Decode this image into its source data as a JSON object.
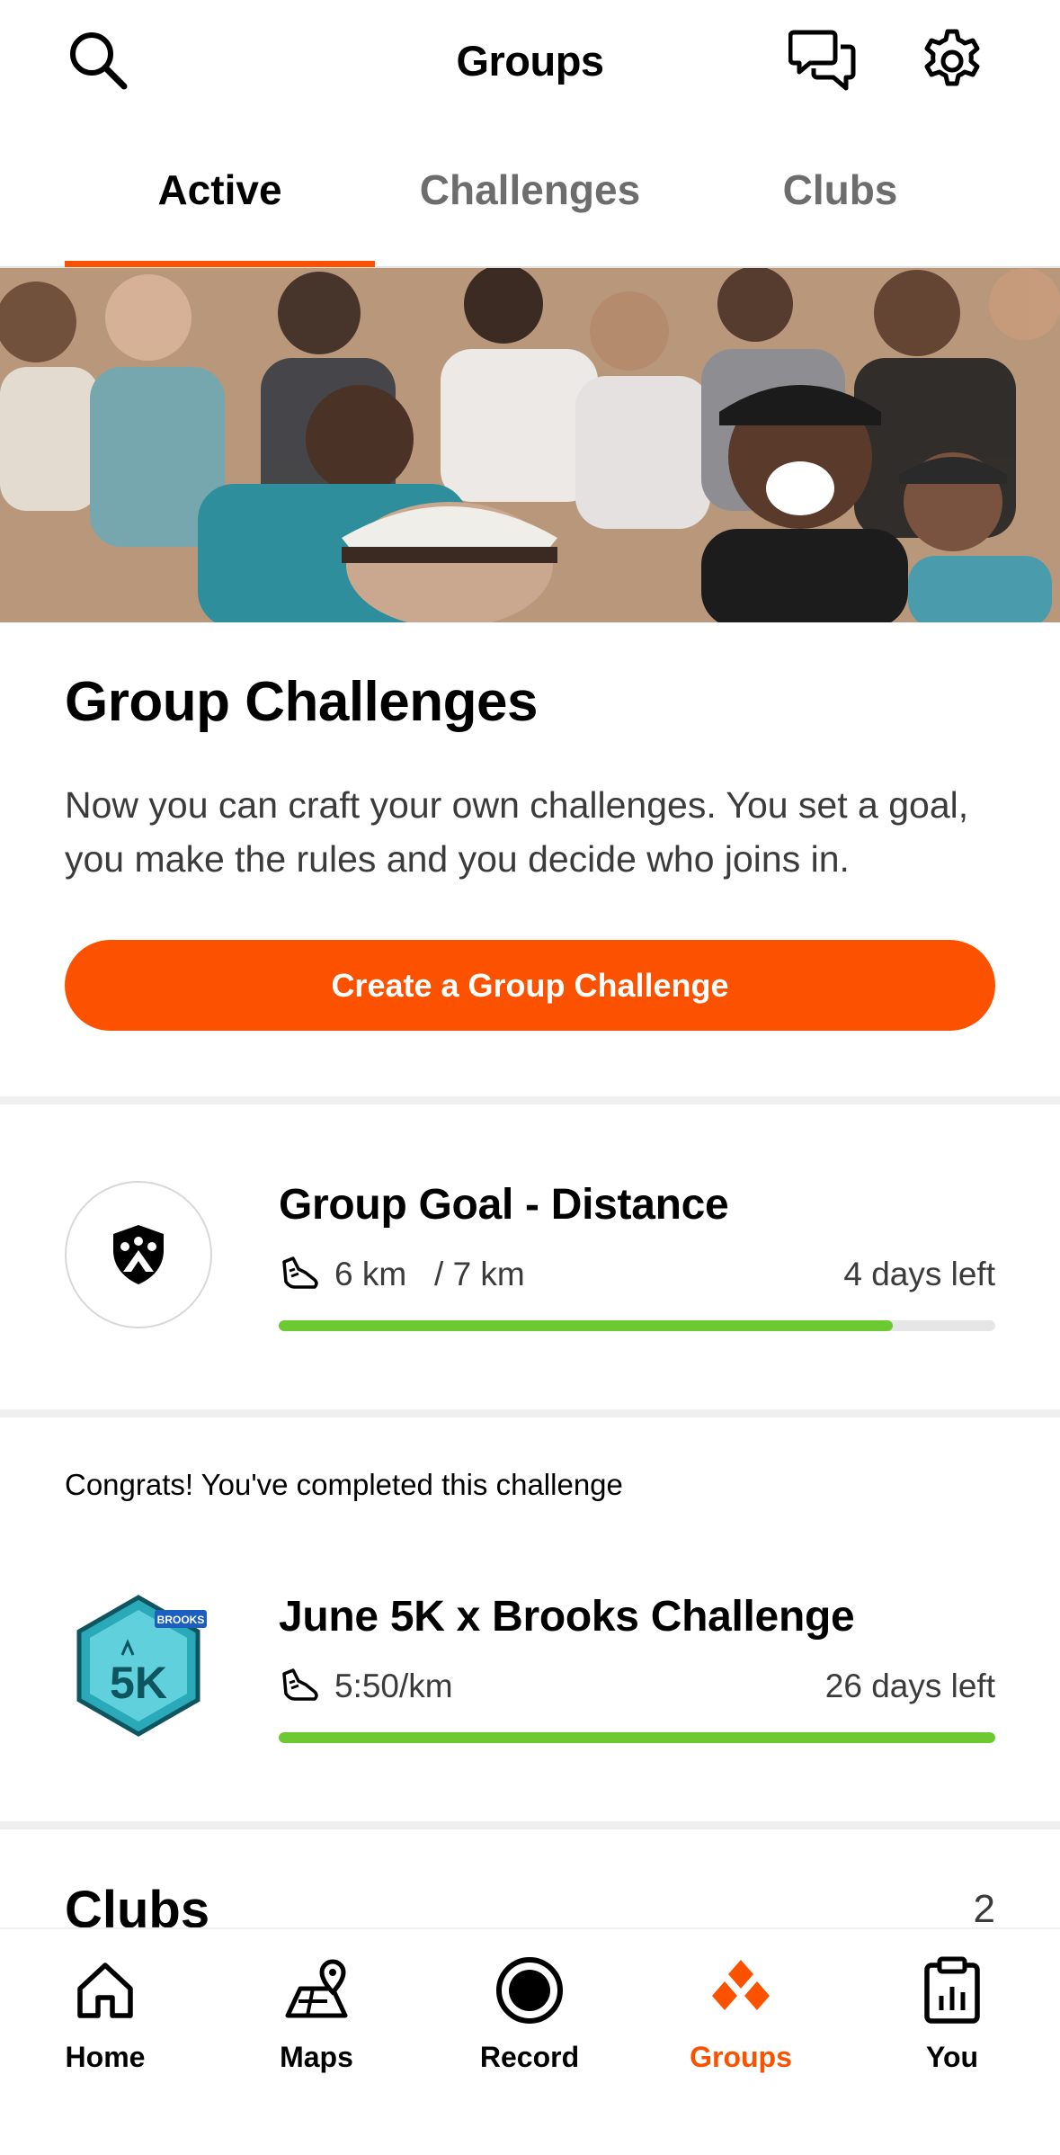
{
  "header": {
    "title": "Groups",
    "icons": [
      "search-icon",
      "chat-icon",
      "gear-icon"
    ]
  },
  "tabs": [
    {
      "label": "Active",
      "active": true
    },
    {
      "label": "Challenges",
      "active": false
    },
    {
      "label": "Clubs",
      "active": false
    }
  ],
  "promo": {
    "title": "Group Challenges",
    "body": "Now you can craft your own challenges. You set a goal, you make the rules and you decide who joins in.",
    "cta_label": "Create a Group Challenge"
  },
  "challenges": [
    {
      "title": "Group Goal - Distance",
      "progress_text": "6 km   / 7 km",
      "time_left": "4 days left",
      "progress": 0.857,
      "badge_icon": "group-shield-icon"
    },
    {
      "congrats": "Congrats! You've completed this challenge",
      "title": "June 5K x Brooks Challenge",
      "progress_text": "5:50/km",
      "time_left": "26 days left",
      "progress": 1.0,
      "badge_icon": "brooks-5k-badge-icon",
      "badge_text": "5K",
      "badge_brand": "BROOKS"
    }
  ],
  "clubs": {
    "title": "Clubs",
    "count": "2"
  },
  "bottom_nav": [
    {
      "label": "Home",
      "icon": "home-icon",
      "active": false
    },
    {
      "label": "Maps",
      "icon": "map-icon",
      "active": false
    },
    {
      "label": "Record",
      "icon": "record-icon",
      "active": false
    },
    {
      "label": "Groups",
      "icon": "groups-icon",
      "active": true
    },
    {
      "label": "You",
      "icon": "clipboard-chart-icon",
      "active": false
    }
  ],
  "colors": {
    "accent": "#fc5200",
    "progress": "#6cc932",
    "track": "#e6e6e6",
    "inactive_text": "#6d6d6d"
  }
}
